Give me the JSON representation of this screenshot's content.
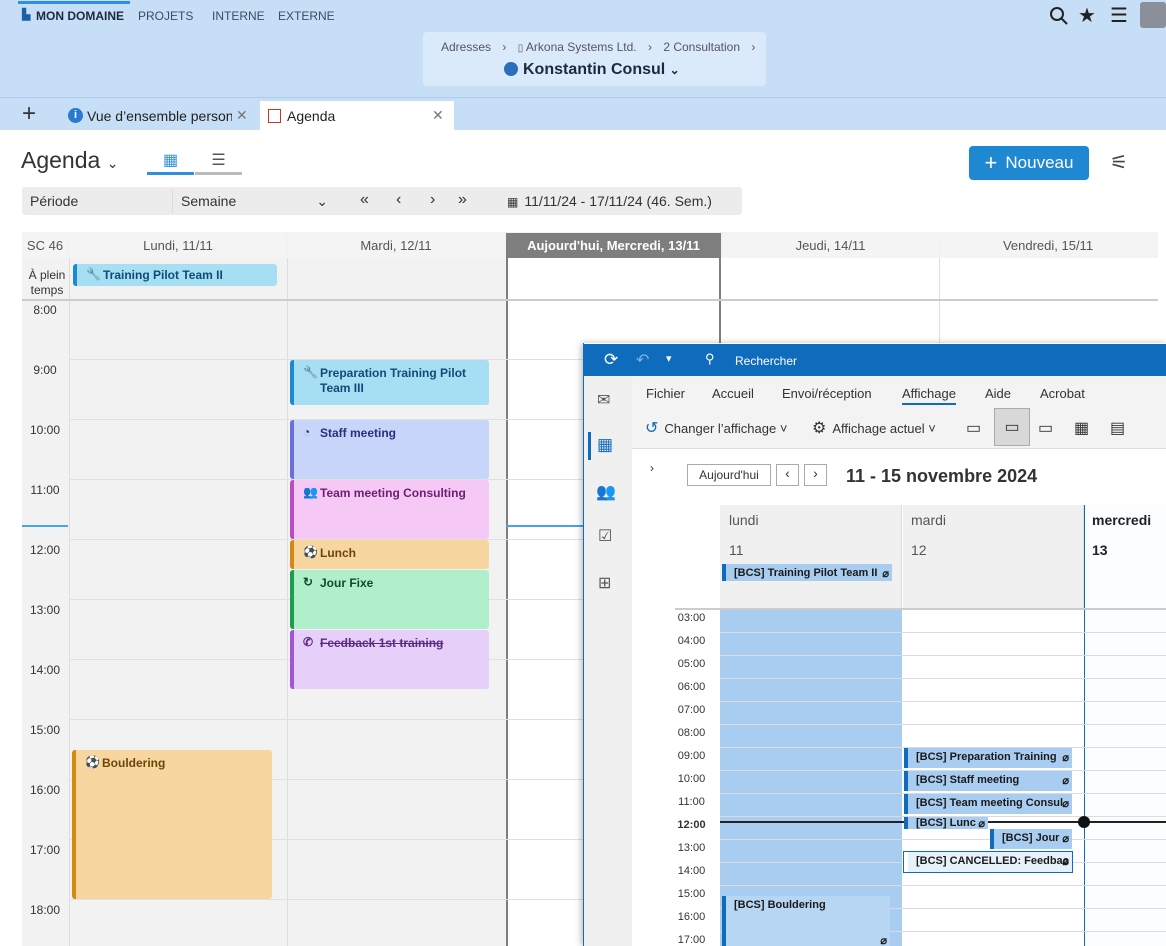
{
  "topnav": {
    "items": [
      "MON DOMAINE",
      "PROJETS",
      "INTERNE",
      "EXTERNE"
    ]
  },
  "breadcrumb": {
    "c1": "Adresses",
    "c2": "Arkona Systems Ltd.",
    "c3": "2 Consultation",
    "person": "Konstantin Consul"
  },
  "tabs": {
    "t1": "Vue d’ensemble personn",
    "t2": "Agenda"
  },
  "agenda": {
    "title": "Agenda",
    "new_label": "Nouveau",
    "period_label": "Période",
    "period_value": "Semaine",
    "range": "11/11/24 - 17/11/24 (46. Sem.)",
    "week": "SC 46",
    "fullday": "À plein temps"
  },
  "days": [
    "Lundi, 11/11",
    "Mardi, 12/11",
    "Aujourd'hui, Mercredi, 13/11",
    "Jeudi, 14/11",
    "Vendredi, 15/11"
  ],
  "hours": [
    "8:00",
    "9:00",
    "10:00",
    "11:00",
    "12:00",
    "13:00",
    "14:00",
    "15:00",
    "16:00",
    "17:00",
    "18:00"
  ],
  "events": {
    "e_training": "Training Pilot Team II",
    "e_prep": "Preparation Training Pilot Team III",
    "e_staff": "Staff meeting",
    "e_team": "Team meeting Consulting",
    "e_lunch": "Lunch",
    "e_jour": "Jour Fixe",
    "e_feedback": "Feedback 1st training",
    "e_boulder": "Bouldering"
  },
  "outlook": {
    "search": "Rechercher",
    "menu": [
      "Fichier",
      "Accueil",
      "Envoi/réception",
      "Affichage",
      "Aide",
      "Acrobat"
    ],
    "change_view": "Changer l’affichage",
    "current_view": "Affichage actuel",
    "today_btn": "Aujourd'hui",
    "range": "11 - 15 novembre 2024",
    "d1": "lundi",
    "d2": "mardi",
    "d3": "mercredi",
    "n1": "11",
    "n2": "12",
    "n3": "13",
    "hours": [
      "03:00",
      "04:00",
      "05:00",
      "06:00",
      "07:00",
      "08:00",
      "09:00",
      "10:00",
      "11:00",
      "12:00",
      "13:00",
      "14:00",
      "15:00",
      "16:00",
      "17:00"
    ],
    "ev_training": "[BCS] Training Pilot Team II",
    "ev_prep": "[BCS] Preparation Training",
    "ev_staff": "[BCS] Staff meeting",
    "ev_team": "[BCS] Team meeting Consul",
    "ev_lunch": "[BCS] Lunc",
    "ev_jour": "[BCS] Jour",
    "ev_cancel": "[BCS] CANCELLED: Feedbac",
    "ev_boulder": "[BCS] Bouldering"
  }
}
